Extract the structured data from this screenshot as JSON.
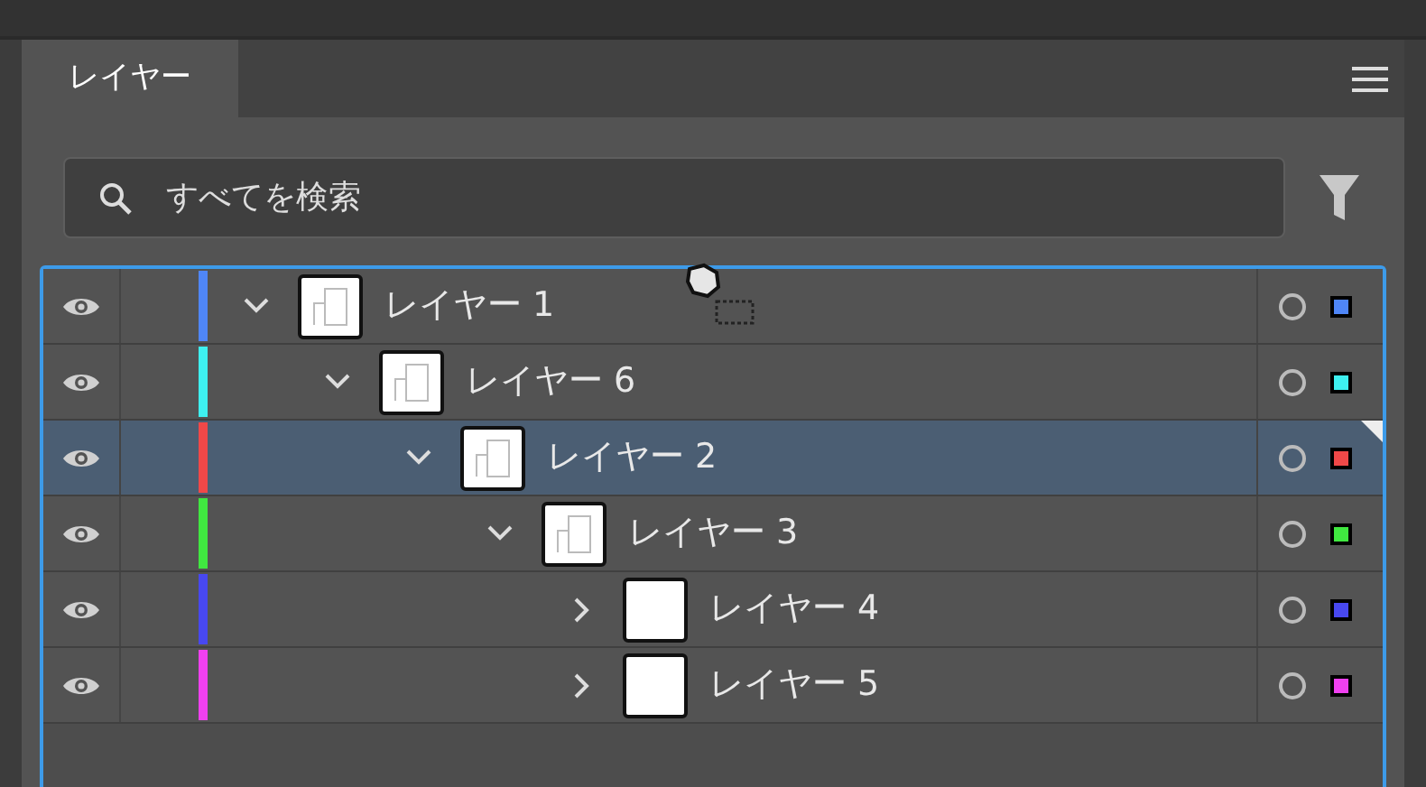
{
  "panel": {
    "tab": {
      "label": "レイヤー",
      "selected": true
    }
  },
  "search": {
    "placeholder": "すべてを検索"
  },
  "layers": [
    {
      "name": "レイヤー 1",
      "color": "#4f86f7",
      "visible": true,
      "expanded": true,
      "selected": false,
      "children": [
        {
          "name": "レイヤー 6",
          "color": "#3ef0f0",
          "visible": true,
          "expanded": true,
          "selected": false,
          "children": [
            {
              "name": "レイヤー 2",
              "color": "#f04848",
              "visible": true,
              "expanded": true,
              "selected": true,
              "children": [
                {
                  "name": "レイヤー 3",
                  "color": "#40e840",
                  "visible": true,
                  "expanded": true,
                  "selected": false,
                  "children": [
                    {
                      "name": "レイヤー 4",
                      "color": "#4848f0",
                      "visible": true,
                      "expanded": false,
                      "selected": false
                    },
                    {
                      "name": "レイヤー 5",
                      "color": "#f040f0",
                      "visible": true,
                      "expanded": false,
                      "selected": false
                    }
                  ]
                }
              ]
            }
          ]
        }
      ]
    }
  ]
}
